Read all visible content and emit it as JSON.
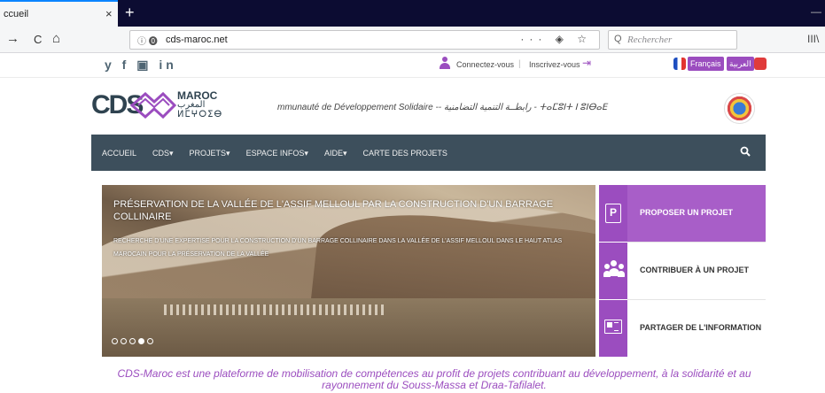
{
  "browser": {
    "tab_title": "ccueil",
    "tab_close": "×",
    "new_tab": "+",
    "back": "→",
    "reload": "C",
    "home": "⌂",
    "url_info": "ⓘ ⓿",
    "url": "cds-maroc.net",
    "url_actions": "··· ◈ ☆",
    "search_glyph": "Q",
    "search_placeholder": "Rechercher",
    "library": "III\\",
    "overflow": "—"
  },
  "topbar": {
    "social_icons": [
      "twitter-icon",
      "facebook-icon",
      "youtube-icon",
      "linkedin-icon"
    ],
    "social_glyphs": "y f ▣ in",
    "login": "Connectez-vous",
    "separator": "|",
    "register": "Inscrivez-vous",
    "register_glyph": "⇥",
    "lang_fr": "Français",
    "lang_ar": "العربية"
  },
  "header": {
    "logo_cds": "CDS",
    "logo_maroc": "MAROC",
    "logo_ar": "المغرب",
    "logo_tif": "ⵍⵎⵖⵔⵉⴱ",
    "tagline": "mmunauté de Développement Solidaire -- رابطــة التنمية التضامنية - ⵜⴰⵎⵓⵏⵜ ⵏ ⵓⵏⴱⴰⴹ"
  },
  "nav": {
    "items": [
      "ACCUEIL",
      "CDS▾",
      "PROJETS▾",
      "ESPACE INFOS▾",
      "AIDE▾",
      "CARTE DES PROJETS"
    ],
    "search_glyph": "🔍︎"
  },
  "hero": {
    "title": "PRÉSERVATION DE LA VALLÉE DE L'ASSIF MELLOUL PAR LA CONSTRUCTION D'UN BARRAGE COLLINAIRE",
    "subtitle": "RECHERCHE D'UNE EXPERTISE POUR LA CONSTRUCTION D'UN BARRAGE COLLINAIRE DANS LA VALLÉE DE L'ASSIF MELLOUL DANS LE HAUT ATLAS MAROCAIN POUR LA PRÉSERVATION DE LA VALLÉE",
    "slide_count": 5,
    "active_slide": 4
  },
  "side_panel": {
    "items": [
      {
        "label": "PROPOSER UN PROJET",
        "icon": "document-p-icon"
      },
      {
        "label": "CONTRIBUER À UN PROJET",
        "icon": "people-icon"
      },
      {
        "label": "PARTAGER DE L'INFORMATION",
        "icon": "newspaper-icon"
      }
    ]
  },
  "intro": {
    "text": "CDS-Maroc est une plateforme de mobilisation de compétences au profit de projets contribuant au développement, à la solidarité et au rayonnement du Souss-Massa et Draa-Tafilalet."
  },
  "colors": {
    "accent": "#9b4dbf",
    "nav_bg": "#3d4f5c",
    "browser_tabbar": "#0c0c32"
  }
}
